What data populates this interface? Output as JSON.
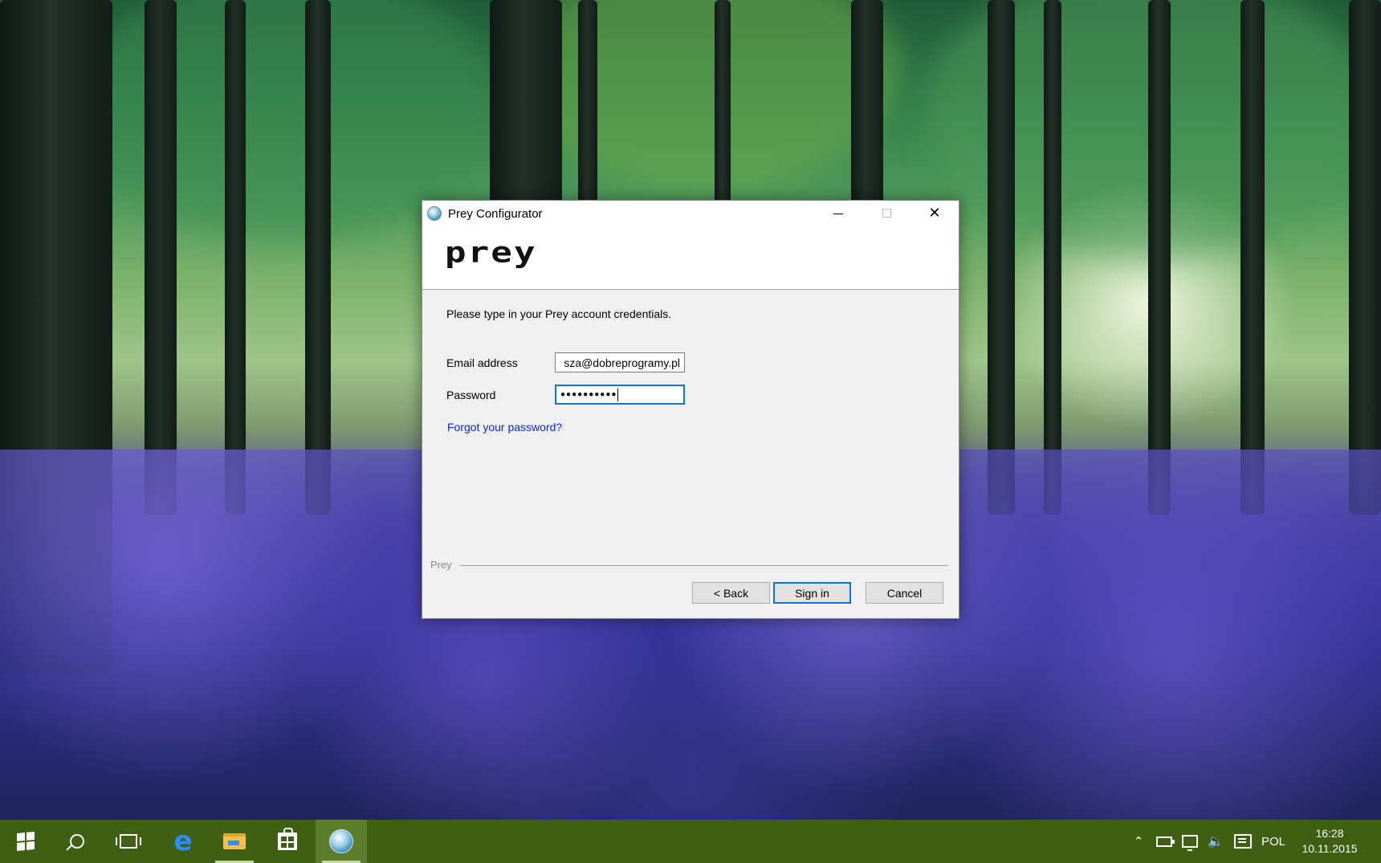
{
  "window": {
    "title": "Prey Configurator",
    "logo_text": "prey",
    "instruction": "Please type in your Prey account credentials.",
    "email_label": "Email address",
    "email_value": "sza@dobreprogramy.pl",
    "password_label": "Password",
    "password_value": "●●●●●●●●●●",
    "forgot_link": "Forgot your password?",
    "group_label": "Prey",
    "buttons": {
      "back": "< Back",
      "sign_in": "Sign in",
      "cancel": "Cancel"
    },
    "controls": {
      "minimize": "minimize-icon",
      "maximize": "maximize-icon",
      "close": "✕"
    }
  },
  "taskbar": {
    "items": [
      "start",
      "search",
      "task-view",
      "edge",
      "file-explorer",
      "store",
      "prey-configurator"
    ],
    "active_item": "prey-configurator",
    "accent_color": "#3f5f12",
    "tray": {
      "chevron": "⌃",
      "volume": "🔈",
      "language": "POL",
      "time": "16:28",
      "date": "10.11.2015"
    }
  }
}
